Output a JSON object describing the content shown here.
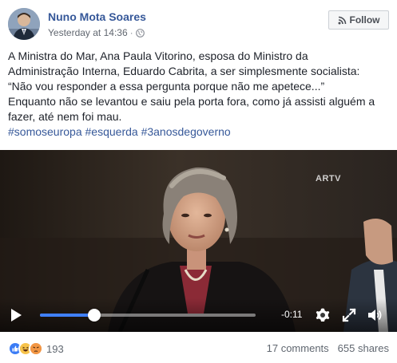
{
  "post": {
    "author": "Nuno Mota Soares",
    "timestamp": "Yesterday at 14:36",
    "separator": "·",
    "privacy_icon": "globe-icon",
    "follow_label": "Follow",
    "text_lines": [
      "A Ministra do Mar, Ana Paula Vitorino, esposa do Ministro da",
      "Administração Interna, Eduardo Cabrita, a ser simplesmente socialista:",
      "“Não vou responder a essa pergunta porque não me apetece...”",
      "Enquanto não se levantou e saiu pela porta fora, como já assisti alguém a",
      "fazer, até nem foi mau."
    ],
    "hashtags": [
      "#somoseuropa",
      "#esquerda",
      "#3anosdegoverno"
    ]
  },
  "video": {
    "watermark": "ARTV",
    "remaining_time": "-0:11",
    "progress": 0.25
  },
  "footer": {
    "reaction_icons": [
      "like-icon",
      "haha-icon",
      "angry-icon"
    ],
    "reaction_count": "193",
    "comments": "17 comments",
    "shares": "655 shares"
  },
  "colors": {
    "link": "#365899",
    "progress": "#4080ff"
  }
}
